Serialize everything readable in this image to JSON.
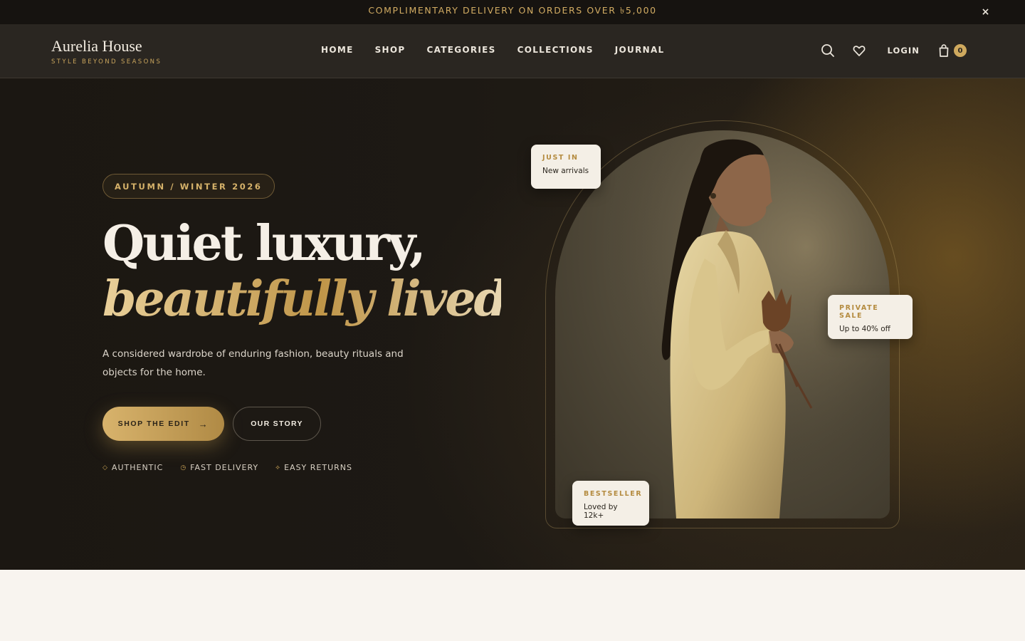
{
  "announcement": {
    "text": "COMPLIMENTARY DELIVERY ON ORDERS OVER ৳5,000",
    "close_label": "×"
  },
  "header": {
    "brand_name": "Aurelia House",
    "brand_tagline": "STYLE BEYOND SEASONS",
    "nav": [
      "HOME",
      "SHOP",
      "CATEGORIES",
      "COLLECTIONS",
      "JOURNAL"
    ],
    "login_label": "LOGIN",
    "cart_count": "0",
    "icons": [
      "search-icon",
      "heart-icon",
      "bag-icon"
    ]
  },
  "hero": {
    "badge": "AUTUMN / WINTER 2026",
    "headline_line1": "Quiet luxury,",
    "headline_line2": "beautifully lived.",
    "description": "A considered wardrobe of enduring fashion, beauty rituals and objects for the home.",
    "primary_cta": "SHOP THE EDIT",
    "primary_cta_arrow": "→",
    "secondary_cta": "OUR STORY",
    "features": [
      {
        "icon": "◇",
        "label": "AUTHENTIC"
      },
      {
        "icon": "◷",
        "label": "FAST DELIVERY"
      },
      {
        "icon": "⟡",
        "label": "EASY RETURNS"
      }
    ]
  },
  "cards": {
    "just_in": {
      "eyebrow": "JUST IN",
      "text": "New arrivals"
    },
    "private_sale": {
      "eyebrow": "PRIVATE SALE",
      "text": "Up to 40% off"
    },
    "bestseller": {
      "eyebrow": "BESTSELLER",
      "text": "Loved by 12k+"
    }
  },
  "colors": {
    "accent_gold": "#cfa95e",
    "dark_bg": "#1b1712",
    "header_bg": "#2a2621",
    "cream": "#f8f4ef"
  }
}
